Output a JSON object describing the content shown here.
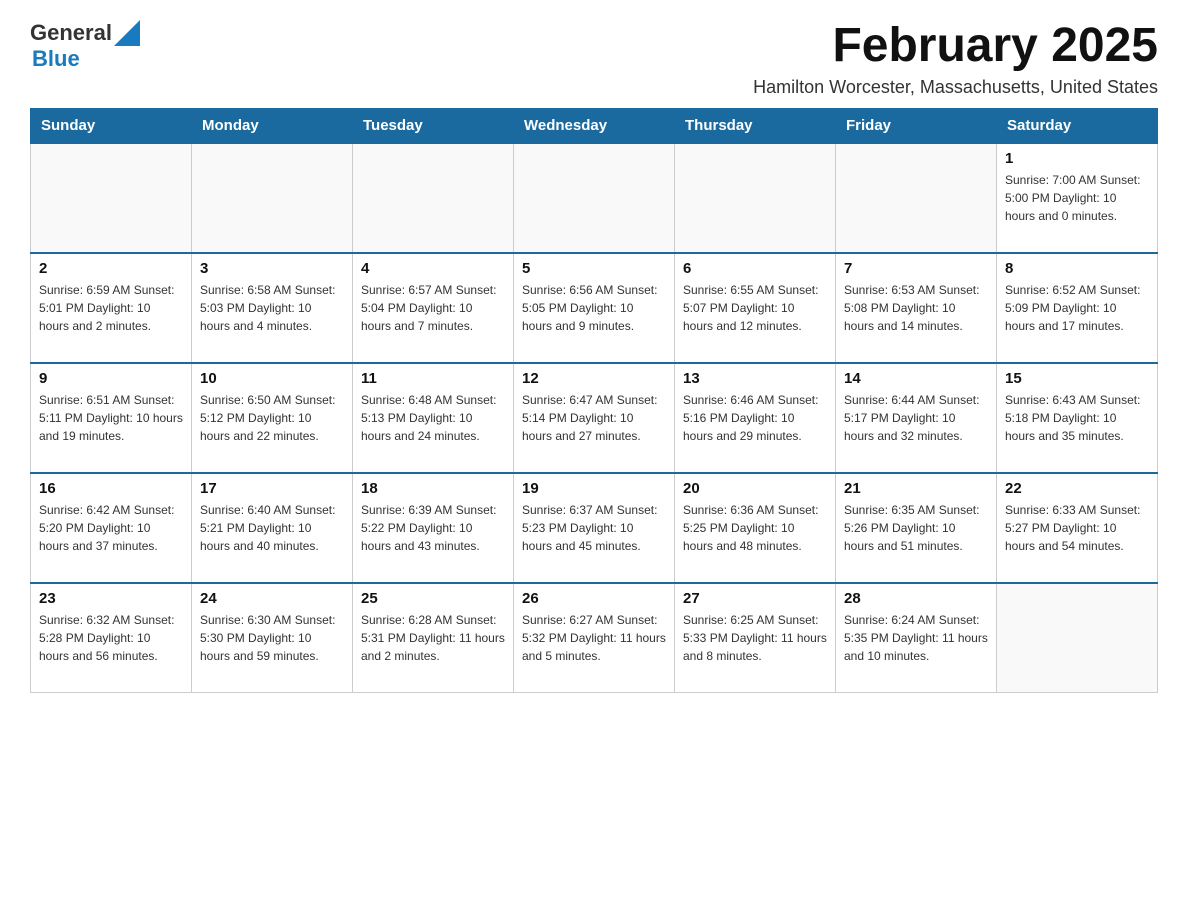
{
  "logo": {
    "text_general": "General",
    "text_blue": "Blue",
    "tagline": "GeneralBlue"
  },
  "header": {
    "month_title": "February 2025",
    "location": "Hamilton Worcester, Massachusetts, United States"
  },
  "days_of_week": [
    "Sunday",
    "Monday",
    "Tuesday",
    "Wednesday",
    "Thursday",
    "Friday",
    "Saturday"
  ],
  "weeks": [
    {
      "days": [
        {
          "num": "",
          "info": ""
        },
        {
          "num": "",
          "info": ""
        },
        {
          "num": "",
          "info": ""
        },
        {
          "num": "",
          "info": ""
        },
        {
          "num": "",
          "info": ""
        },
        {
          "num": "",
          "info": ""
        },
        {
          "num": "1",
          "info": "Sunrise: 7:00 AM\nSunset: 5:00 PM\nDaylight: 10 hours and 0 minutes."
        }
      ]
    },
    {
      "days": [
        {
          "num": "2",
          "info": "Sunrise: 6:59 AM\nSunset: 5:01 PM\nDaylight: 10 hours and 2 minutes."
        },
        {
          "num": "3",
          "info": "Sunrise: 6:58 AM\nSunset: 5:03 PM\nDaylight: 10 hours and 4 minutes."
        },
        {
          "num": "4",
          "info": "Sunrise: 6:57 AM\nSunset: 5:04 PM\nDaylight: 10 hours and 7 minutes."
        },
        {
          "num": "5",
          "info": "Sunrise: 6:56 AM\nSunset: 5:05 PM\nDaylight: 10 hours and 9 minutes."
        },
        {
          "num": "6",
          "info": "Sunrise: 6:55 AM\nSunset: 5:07 PM\nDaylight: 10 hours and 12 minutes."
        },
        {
          "num": "7",
          "info": "Sunrise: 6:53 AM\nSunset: 5:08 PM\nDaylight: 10 hours and 14 minutes."
        },
        {
          "num": "8",
          "info": "Sunrise: 6:52 AM\nSunset: 5:09 PM\nDaylight: 10 hours and 17 minutes."
        }
      ]
    },
    {
      "days": [
        {
          "num": "9",
          "info": "Sunrise: 6:51 AM\nSunset: 5:11 PM\nDaylight: 10 hours and 19 minutes."
        },
        {
          "num": "10",
          "info": "Sunrise: 6:50 AM\nSunset: 5:12 PM\nDaylight: 10 hours and 22 minutes."
        },
        {
          "num": "11",
          "info": "Sunrise: 6:48 AM\nSunset: 5:13 PM\nDaylight: 10 hours and 24 minutes."
        },
        {
          "num": "12",
          "info": "Sunrise: 6:47 AM\nSunset: 5:14 PM\nDaylight: 10 hours and 27 minutes."
        },
        {
          "num": "13",
          "info": "Sunrise: 6:46 AM\nSunset: 5:16 PM\nDaylight: 10 hours and 29 minutes."
        },
        {
          "num": "14",
          "info": "Sunrise: 6:44 AM\nSunset: 5:17 PM\nDaylight: 10 hours and 32 minutes."
        },
        {
          "num": "15",
          "info": "Sunrise: 6:43 AM\nSunset: 5:18 PM\nDaylight: 10 hours and 35 minutes."
        }
      ]
    },
    {
      "days": [
        {
          "num": "16",
          "info": "Sunrise: 6:42 AM\nSunset: 5:20 PM\nDaylight: 10 hours and 37 minutes."
        },
        {
          "num": "17",
          "info": "Sunrise: 6:40 AM\nSunset: 5:21 PM\nDaylight: 10 hours and 40 minutes."
        },
        {
          "num": "18",
          "info": "Sunrise: 6:39 AM\nSunset: 5:22 PM\nDaylight: 10 hours and 43 minutes."
        },
        {
          "num": "19",
          "info": "Sunrise: 6:37 AM\nSunset: 5:23 PM\nDaylight: 10 hours and 45 minutes."
        },
        {
          "num": "20",
          "info": "Sunrise: 6:36 AM\nSunset: 5:25 PM\nDaylight: 10 hours and 48 minutes."
        },
        {
          "num": "21",
          "info": "Sunrise: 6:35 AM\nSunset: 5:26 PM\nDaylight: 10 hours and 51 minutes."
        },
        {
          "num": "22",
          "info": "Sunrise: 6:33 AM\nSunset: 5:27 PM\nDaylight: 10 hours and 54 minutes."
        }
      ]
    },
    {
      "days": [
        {
          "num": "23",
          "info": "Sunrise: 6:32 AM\nSunset: 5:28 PM\nDaylight: 10 hours and 56 minutes."
        },
        {
          "num": "24",
          "info": "Sunrise: 6:30 AM\nSunset: 5:30 PM\nDaylight: 10 hours and 59 minutes."
        },
        {
          "num": "25",
          "info": "Sunrise: 6:28 AM\nSunset: 5:31 PM\nDaylight: 11 hours and 2 minutes."
        },
        {
          "num": "26",
          "info": "Sunrise: 6:27 AM\nSunset: 5:32 PM\nDaylight: 11 hours and 5 minutes."
        },
        {
          "num": "27",
          "info": "Sunrise: 6:25 AM\nSunset: 5:33 PM\nDaylight: 11 hours and 8 minutes."
        },
        {
          "num": "28",
          "info": "Sunrise: 6:24 AM\nSunset: 5:35 PM\nDaylight: 11 hours and 10 minutes."
        },
        {
          "num": "",
          "info": ""
        }
      ]
    }
  ]
}
